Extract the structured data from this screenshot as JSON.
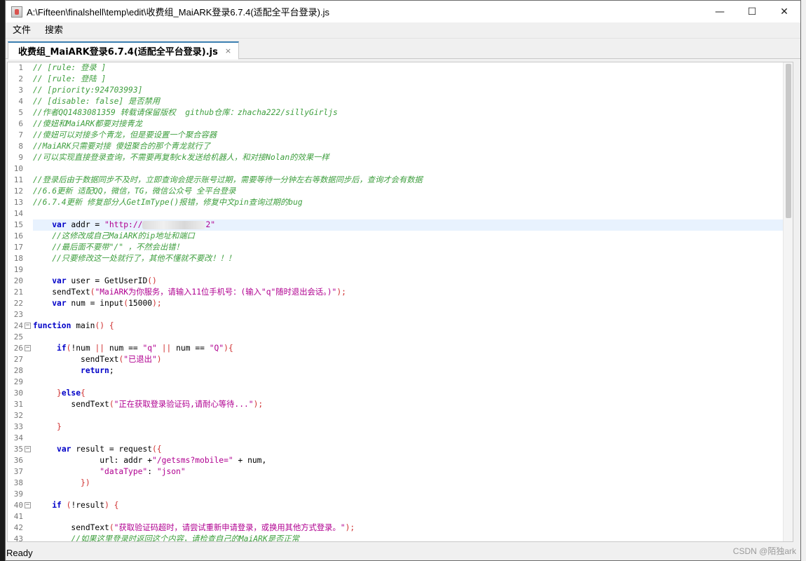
{
  "window": {
    "title": "A:\\Fifteen\\finalshell\\temp\\edit\\收费组_MaiARK登录6.7.4(适配全平台登录).js",
    "minimize_label": "—",
    "maximize_label": "☐",
    "close_label": "✕"
  },
  "menu": [
    "文件",
    "搜索"
  ],
  "tab": {
    "label": "收费组_MaiARK登录6.7.4(适配全平台登录).js",
    "close_label": "×"
  },
  "code_lines": [
    {
      "n": "1",
      "t": "// [rule: 登录 ]",
      "cls": "cm"
    },
    {
      "n": "2",
      "t": "// [rule: 登陆 ]",
      "cls": "cm"
    },
    {
      "n": "3",
      "t": "// [priority:924703993]",
      "cls": "cm"
    },
    {
      "n": "4",
      "t": "// [disable: false] 是否禁用",
      "cls": "cm"
    },
    {
      "n": "5",
      "t": "//作者QQ1483081359 转载请保留版权  github仓库：zhacha222/sillyGirljs",
      "cls": "cm"
    },
    {
      "n": "6",
      "t": "//傻妞和MaiARK都要对接青龙",
      "cls": "cm"
    },
    {
      "n": "7",
      "t": "//傻妞可以对接多个青龙，但是要设置一个聚合容器",
      "cls": "cm"
    },
    {
      "n": "8",
      "t": "//MaiARK只需要对接 傻妞聚合的那个青龙就行了",
      "cls": "cm"
    },
    {
      "n": "9",
      "t": "//可以实现直接登录查询，不需要再复制ck发送给机器人，和对接Nolan的效果一样",
      "cls": "cm"
    },
    {
      "n": "10",
      "t": "",
      "cls": ""
    },
    {
      "n": "11",
      "t": "//登录后由于数据同步不及时，立即查询会提示账号过期，需要等待一分钟左右等数据同步后，查询才会有数据",
      "cls": "cm"
    },
    {
      "n": "12",
      "t": "//6.6更新 适配QQ，微信，TG，微信公众号 全平台登录",
      "cls": "cm"
    },
    {
      "n": "13",
      "t": "//6.7.4更新 修复部分人GetImType()报错，修复中文pin查询过期的bug",
      "cls": "cm"
    },
    {
      "n": "14",
      "t": "",
      "cls": ""
    },
    {
      "n": "15",
      "t": "",
      "cls": "",
      "special": "addr"
    },
    {
      "n": "16",
      "t": "    //这修改成自己MaiARK的ip地址和端口",
      "cls": "cm"
    },
    {
      "n": "17",
      "t": "    //最后面不要带\"/\" ，不然会出错！",
      "cls": "cm"
    },
    {
      "n": "18",
      "t": "    //只要修改这一处就行了，其他不懂就不要改！！！",
      "cls": "cm"
    },
    {
      "n": "19",
      "t": "",
      "cls": ""
    },
    {
      "n": "20",
      "t": "",
      "cls": "",
      "special": "user"
    },
    {
      "n": "21",
      "t": "",
      "cls": "",
      "special": "send1"
    },
    {
      "n": "22",
      "t": "",
      "cls": "",
      "special": "num"
    },
    {
      "n": "23",
      "t": "",
      "cls": ""
    },
    {
      "n": "24",
      "t": "",
      "cls": "",
      "special": "func",
      "fold": true
    },
    {
      "n": "25",
      "t": "",
      "cls": ""
    },
    {
      "n": "26",
      "t": "",
      "cls": "",
      "special": "if1",
      "fold": true
    },
    {
      "n": "27",
      "t": "",
      "cls": "",
      "special": "send2"
    },
    {
      "n": "28",
      "t": "",
      "cls": "",
      "special": "ret"
    },
    {
      "n": "29",
      "t": "",
      "cls": ""
    },
    {
      "n": "30",
      "t": "",
      "cls": "",
      "special": "else"
    },
    {
      "n": "31",
      "t": "",
      "cls": "",
      "special": "send3"
    },
    {
      "n": "32",
      "t": "",
      "cls": ""
    },
    {
      "n": "33",
      "t": "",
      "cls": "",
      "special": "close1"
    },
    {
      "n": "34",
      "t": "",
      "cls": ""
    },
    {
      "n": "35",
      "t": "",
      "cls": "",
      "special": "result",
      "fold": true
    },
    {
      "n": "36",
      "t": "",
      "cls": "",
      "special": "url"
    },
    {
      "n": "37",
      "t": "",
      "cls": "",
      "special": "dtype"
    },
    {
      "n": "38",
      "t": "",
      "cls": "",
      "special": "close2"
    },
    {
      "n": "39",
      "t": "",
      "cls": ""
    },
    {
      "n": "40",
      "t": "",
      "cls": "",
      "special": "if2",
      "fold": true
    },
    {
      "n": "41",
      "t": "",
      "cls": ""
    },
    {
      "n": "42",
      "t": "",
      "cls": "",
      "special": "send4"
    },
    {
      "n": "43",
      "t": "        //如果这里登录时返回这个内容，请检查自己的MaiARK是否正常",
      "cls": "cm"
    }
  ],
  "code_tokens": {
    "addr": [
      [
        "    ",
        ""
      ],
      [
        "var",
        "kw"
      ],
      [
        " addr = ",
        "nu"
      ],
      [
        "\"http://",
        "st"
      ],
      [
        "",
        "blur"
      ],
      [
        "2\"",
        "st"
      ]
    ],
    "user": [
      [
        "    ",
        ""
      ],
      [
        "var",
        "kw"
      ],
      [
        " user = GetUserID",
        "nu"
      ],
      [
        "()",
        "pu"
      ]
    ],
    "send1": [
      [
        "    sendText",
        "nu"
      ],
      [
        "(",
        "pu"
      ],
      [
        "\"MaiARK为你服务，请输入11位手机号：(输入\"q\"随时退出会话。)\"",
        "st"
      ],
      [
        ");",
        "pu"
      ]
    ],
    "num": [
      [
        "    ",
        ""
      ],
      [
        "var",
        "kw"
      ],
      [
        " num = input",
        "nu"
      ],
      [
        "(",
        "pu"
      ],
      [
        "15000",
        "nu"
      ],
      [
        ");",
        "pu"
      ]
    ],
    "func": [
      [
        "function",
        "kw"
      ],
      [
        " main",
        "nu"
      ],
      [
        "()",
        "pu"
      ],
      [
        " {",
        "pu"
      ]
    ],
    "if1": [
      [
        "     ",
        ""
      ],
      [
        "if",
        "kw"
      ],
      [
        "(",
        "pu"
      ],
      [
        "!num ",
        "nu"
      ],
      [
        "||",
        "pu"
      ],
      [
        " num == ",
        "nu"
      ],
      [
        "\"q\"",
        "st"
      ],
      [
        " ",
        ""
      ],
      [
        "||",
        "pu"
      ],
      [
        " num == ",
        "nu"
      ],
      [
        "\"Q\"",
        "st"
      ],
      [
        "){",
        "pu"
      ]
    ],
    "send2": [
      [
        "          sendText",
        "nu"
      ],
      [
        "(",
        "pu"
      ],
      [
        "\"已退出\"",
        "st"
      ],
      [
        ")",
        "pu"
      ]
    ],
    "ret": [
      [
        "          ",
        ""
      ],
      [
        "return",
        "kw"
      ],
      [
        ";",
        "nu"
      ]
    ],
    "else": [
      [
        "     ",
        ""
      ],
      [
        "}",
        "pu"
      ],
      [
        "else",
        "kw"
      ],
      [
        "{",
        "pu"
      ]
    ],
    "send3": [
      [
        "        sendText",
        "nu"
      ],
      [
        "(",
        "pu"
      ],
      [
        "\"正在获取登录验证码,请耐心等待...\"",
        "st"
      ],
      [
        ");",
        "pu"
      ]
    ],
    "close1": [
      [
        "     ",
        ""
      ],
      [
        "}",
        "pu"
      ]
    ],
    "result": [
      [
        "     ",
        ""
      ],
      [
        "var",
        "kw"
      ],
      [
        " result = request",
        "nu"
      ],
      [
        "({",
        "pu"
      ]
    ],
    "url": [
      [
        "              url: addr +",
        "nu"
      ],
      [
        "\"/getsms?mobile=\"",
        "st"
      ],
      [
        " + num,",
        "nu"
      ]
    ],
    "dtype": [
      [
        "              ",
        ""
      ],
      [
        "\"dataType\"",
        "st"
      ],
      [
        ": ",
        "nu"
      ],
      [
        "\"json\"",
        "st"
      ]
    ],
    "close2": [
      [
        "          ",
        ""
      ],
      [
        "})",
        "pu"
      ]
    ],
    "if2": [
      [
        "    ",
        ""
      ],
      [
        "if",
        "kw"
      ],
      [
        " ",
        ""
      ],
      [
        "(",
        "pu"
      ],
      [
        "!result",
        "nu"
      ],
      [
        ")",
        "pu"
      ],
      [
        " {",
        "pu"
      ]
    ],
    "send4": [
      [
        "        sendText",
        "nu"
      ],
      [
        "(",
        "pu"
      ],
      [
        "\"获取验证码超时，请尝试重新申请登录，或换用其他方式登录。\"",
        "st"
      ],
      [
        ");",
        "pu"
      ]
    ]
  },
  "current_line": "15",
  "status": {
    "text": "Ready"
  },
  "watermark": "CSDN @陌独ark"
}
